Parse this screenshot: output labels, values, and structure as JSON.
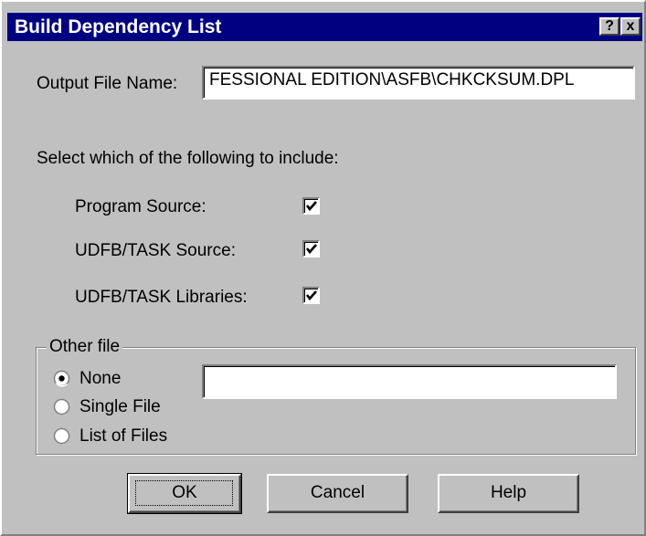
{
  "window": {
    "title": "Build Dependency List",
    "help_glyph": "?",
    "close_glyph": "x"
  },
  "output": {
    "label": "Output File Name:",
    "value": "FESSIONAL EDITION\\ASFB\\CHKCKSUM.DPL"
  },
  "include": {
    "prompt": "Select which of the following to include:",
    "items": [
      {
        "label": "Program Source:",
        "checked": true
      },
      {
        "label": "UDFB/TASK Source:",
        "checked": true
      },
      {
        "label": "UDFB/TASK Libraries:",
        "checked": true
      }
    ]
  },
  "other_file": {
    "legend": "Other file",
    "options": [
      {
        "label": "None",
        "selected": true
      },
      {
        "label": "Single File",
        "selected": false
      },
      {
        "label": "List of Files",
        "selected": false
      }
    ],
    "path_value": ""
  },
  "buttons": {
    "ok": "OK",
    "cancel": "Cancel",
    "help": "Help"
  }
}
